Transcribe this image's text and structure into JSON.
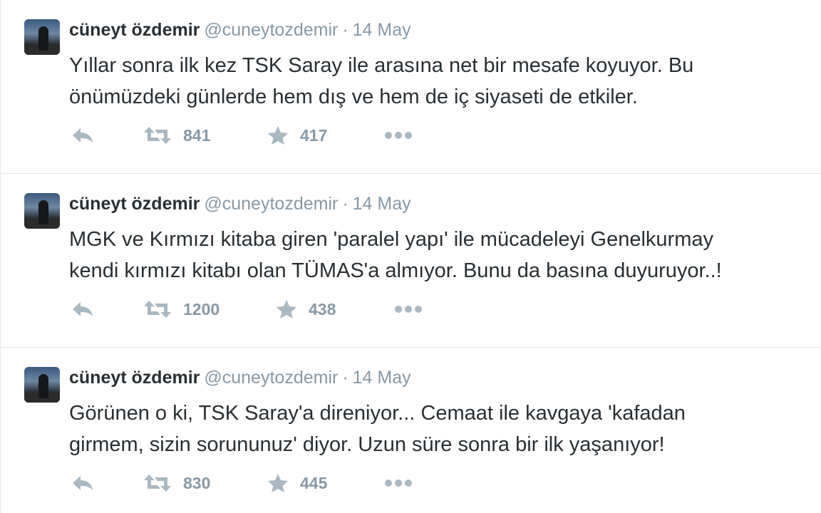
{
  "tweets": [
    {
      "name": "cüneyt özdemir",
      "handle": "@cuneytozdemir",
      "separator": "·",
      "date": "14 May",
      "line1": "Yıllar sonra ilk kez TSK Saray ile arasına net bir mesafe koyuyor. Bu",
      "line2": "önümüzdeki günlerde hem dış ve hem de iç siyaseti de etkiler.",
      "retweets": "841",
      "favorites": "417"
    },
    {
      "name": "cüneyt özdemir",
      "handle": "@cuneytozdemir",
      "separator": "·",
      "date": "14 May",
      "line1": "MGK ve Kırmızı kitaba giren 'paralel yapı' ile mücadeleyi Genelkurmay",
      "line2": "kendi kırmızı kitabı olan TÜMAS'a almıyor. Bunu da basına duyuruyor..!",
      "retweets": "1200",
      "favorites": "438"
    },
    {
      "name": "cüneyt özdemir",
      "handle": "@cuneytozdemir",
      "separator": "·",
      "date": "14 May",
      "line1": "Görünen o ki, TSK Saray'a direniyor... Cemaat ile kavgaya 'kafadan",
      "line2": "girmem, sizin sorununuz' diyor. Uzun süre sonra bir ilk yaşanıyor!",
      "retweets": "830",
      "favorites": "445"
    }
  ],
  "icons": {
    "reply": "reply-icon",
    "retweet": "retweet-icon",
    "favorite": "star-icon",
    "more": "more-icon"
  },
  "colors": {
    "text": "#292f33",
    "muted": "#8899a6",
    "icon": "#aab8c2",
    "divider": "#e1e8ed"
  }
}
